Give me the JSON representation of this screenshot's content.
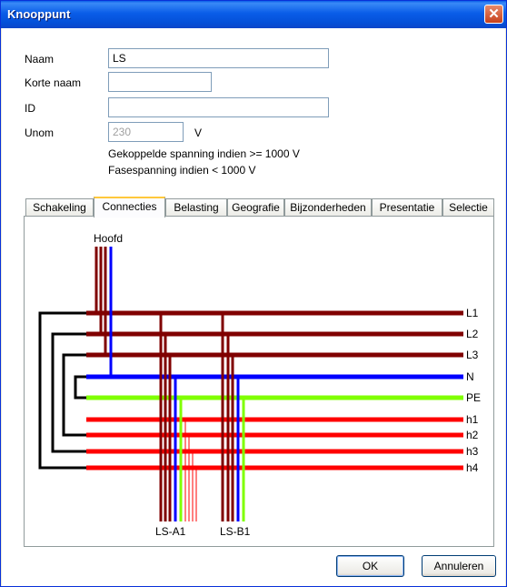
{
  "window": {
    "title": "Knooppunt",
    "close_glyph": "✕"
  },
  "form": {
    "naam_label": "Naam",
    "naam_value": "LS",
    "korte_naam_label": "Korte naam",
    "korte_naam_value": "",
    "id_label": "ID",
    "id_value": "",
    "unom_label": "Unom",
    "unom_value": "230",
    "unom_unit": "V",
    "note1": "Gekoppelde spanning indien >= 1000 V",
    "note2": "Fasespanning indien < 1000 V"
  },
  "tabs": [
    "Schakeling",
    "Connecties",
    "Belasting",
    "Geografie",
    "Bijzonderheden",
    "Presentatie",
    "Selectie"
  ],
  "active_tab": "Connecties",
  "diagram": {
    "top_label": "Hoofd",
    "buses": [
      "L1",
      "L2",
      "L3",
      "N",
      "PE",
      "h1",
      "h2",
      "h3",
      "h4"
    ],
    "bottom_labels": [
      "LS-A1",
      "LS-B1"
    ],
    "colors": {
      "phase": "#800000",
      "neutral": "#0000FF",
      "earth": "#80FF00",
      "aux": "#FF0000",
      "link": "#000000"
    }
  },
  "buttons": {
    "ok": "OK",
    "cancel": "Annuleren"
  }
}
